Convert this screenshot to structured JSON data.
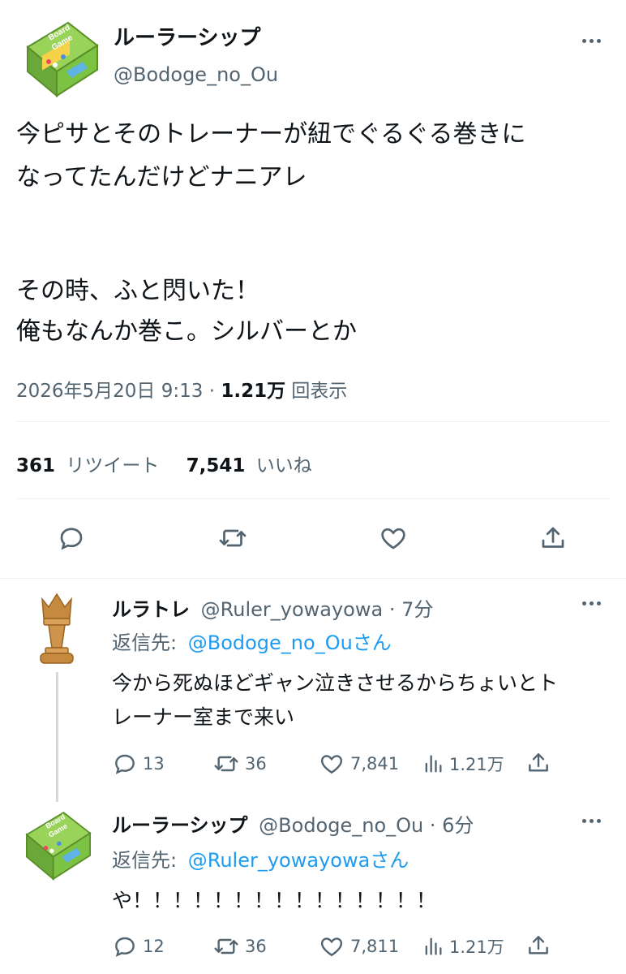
{
  "main_tweet": {
    "display_name": "ルーラーシップ",
    "handle": "@Bodoge_no_Ou",
    "avatar_text": [
      "Board",
      "Game"
    ],
    "lines": [
      "今ピサとそのトレーナーが紐でぐるぐる巻きに",
      "なってたんだけどナニアレ",
      "その時、ふと閃いた！",
      "俺もなんか巻こ。シルバーとか"
    ],
    "datetime": "2026年5月20日 9:13",
    "view_count": "1.21万",
    "view_label": "回表示",
    "retweet_count": "361",
    "retweet_label": "リツイート",
    "like_count": "7,541",
    "like_label": "いいね"
  },
  "replies": [
    {
      "display_name": "ルラトレ",
      "handle": "@Ruler_yowayowa",
      "time": "7分",
      "reply_to_label": "返信先:",
      "reply_to_handle": "@Bodoge_no_Ou",
      "reply_to_suffix": "さん",
      "lines": [
        "今から死ぬほどギャン泣きさせるからちょいとト",
        "レーナー室まで来い"
      ],
      "replies": "13",
      "retweets": "36",
      "likes": "7,841",
      "views": "1.21万"
    },
    {
      "display_name": "ルーラーシップ",
      "handle": "@Bodoge_no_Ou",
      "time": "6分",
      "reply_to_label": "返信先:",
      "reply_to_handle": "@Ruler_yowayowa",
      "reply_to_suffix": "さん",
      "lines": [
        "や！！！！！！！！！！！！！！！"
      ],
      "replies": "12",
      "retweets": "36",
      "likes": "7,811",
      "views": "1.21万"
    }
  ],
  "colors": {
    "link": "#1d9bf0",
    "muted": "#536471",
    "avatar_book": "#7cc243"
  }
}
